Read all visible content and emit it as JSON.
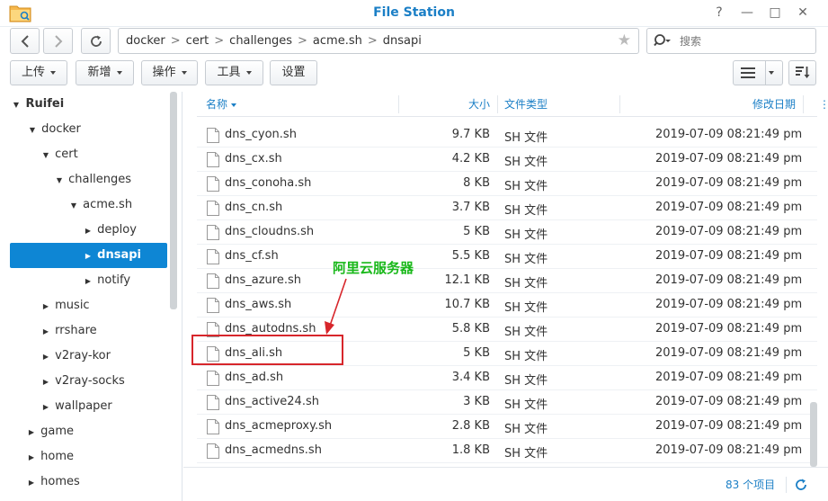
{
  "window": {
    "title": "File Station",
    "buttons": {
      "help": "?",
      "minimize": "—",
      "maximize": "□",
      "close": "✕"
    }
  },
  "path": {
    "crumbs": [
      "docker",
      "cert",
      "challenges",
      "acme.sh",
      "dnsapi"
    ],
    "separator": ">"
  },
  "search": {
    "placeholder": "搜索"
  },
  "toolbar": {
    "upload": "上传",
    "create": "新增",
    "action": "操作",
    "tools": "工具",
    "settings": "设置"
  },
  "sidebar": {
    "items": [
      {
        "label": "Ruifei",
        "expander": "▼"
      },
      {
        "label": "docker",
        "expander": "▼"
      },
      {
        "label": "cert",
        "expander": "▼"
      },
      {
        "label": "challenges",
        "expander": "▼"
      },
      {
        "label": "acme.sh",
        "expander": "▼"
      },
      {
        "label": "deploy",
        "expander": "▶"
      },
      {
        "label": "dnsapi",
        "expander": "▶"
      },
      {
        "label": "notify",
        "expander": "▶"
      },
      {
        "label": "music",
        "expander": "▶"
      },
      {
        "label": "rrshare",
        "expander": "▶"
      },
      {
        "label": "v2ray-kor",
        "expander": "▶"
      },
      {
        "label": "v2ray-socks",
        "expander": "▶"
      },
      {
        "label": "wallpaper",
        "expander": "▶"
      },
      {
        "label": "game",
        "expander": "▶"
      },
      {
        "label": "home",
        "expander": "▶"
      },
      {
        "label": "homes",
        "expander": "▶"
      }
    ]
  },
  "columns": {
    "name": "名称",
    "size": "大小",
    "type": "文件类型",
    "modified": "修改日期"
  },
  "files": [
    {
      "name": "dns_cyon.sh",
      "size": "9.7 KB",
      "type": "SH 文件",
      "modified": "2019-07-09 08:21:49 pm"
    },
    {
      "name": "dns_cx.sh",
      "size": "4.2 KB",
      "type": "SH 文件",
      "modified": "2019-07-09 08:21:49 pm"
    },
    {
      "name": "dns_conoha.sh",
      "size": "8 KB",
      "type": "SH 文件",
      "modified": "2019-07-09 08:21:49 pm"
    },
    {
      "name": "dns_cn.sh",
      "size": "3.7 KB",
      "type": "SH 文件",
      "modified": "2019-07-09 08:21:49 pm"
    },
    {
      "name": "dns_cloudns.sh",
      "size": "5 KB",
      "type": "SH 文件",
      "modified": "2019-07-09 08:21:49 pm"
    },
    {
      "name": "dns_cf.sh",
      "size": "5.5 KB",
      "type": "SH 文件",
      "modified": "2019-07-09 08:21:49 pm"
    },
    {
      "name": "dns_azure.sh",
      "size": "12.1 KB",
      "type": "SH 文件",
      "modified": "2019-07-09 08:21:49 pm"
    },
    {
      "name": "dns_aws.sh",
      "size": "10.7 KB",
      "type": "SH 文件",
      "modified": "2019-07-09 08:21:49 pm"
    },
    {
      "name": "dns_autodns.sh",
      "size": "5.8 KB",
      "type": "SH 文件",
      "modified": "2019-07-09 08:21:49 pm"
    },
    {
      "name": "dns_ali.sh",
      "size": "5 KB",
      "type": "SH 文件",
      "modified": "2019-07-09 08:21:49 pm"
    },
    {
      "name": "dns_ad.sh",
      "size": "3.4 KB",
      "type": "SH 文件",
      "modified": "2019-07-09 08:21:49 pm"
    },
    {
      "name": "dns_active24.sh",
      "size": "3 KB",
      "type": "SH 文件",
      "modified": "2019-07-09 08:21:49 pm"
    },
    {
      "name": "dns_acmeproxy.sh",
      "size": "2.8 KB",
      "type": "SH 文件",
      "modified": "2019-07-09 08:21:49 pm"
    },
    {
      "name": "dns_acmedns.sh",
      "size": "1.8 KB",
      "type": "SH 文件",
      "modified": "2019-07-09 08:21:49 pm"
    }
  ],
  "footer": {
    "count": "83 个项目"
  },
  "annotation": {
    "label": "阿里云服务器",
    "label_color": "#19b81a",
    "box_color": "#d7262b"
  },
  "colors": {
    "accent": "#1b7fc6",
    "selection": "#0e86d4"
  }
}
